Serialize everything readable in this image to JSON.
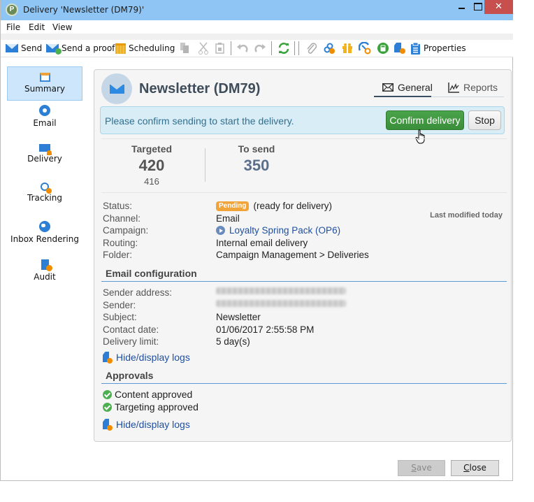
{
  "window": {
    "title": "Delivery 'Newsletter (DM79)'",
    "controls": {
      "minimize": "minimize",
      "maximize": "maximize",
      "close": "✕"
    }
  },
  "menu": [
    "File",
    "Edit",
    "View"
  ],
  "toolbar": {
    "send": "Send",
    "send_proof": "Send a proof",
    "scheduling": "Scheduling",
    "properties": "Properties",
    "icons": [
      "copy-icon",
      "cut-icon",
      "paste-icon",
      "undo-icon",
      "redo-icon",
      "refresh-icon",
      "attachment-icon",
      "tracked-link-icon",
      "offers-icon",
      "delivery-monitoring-icon",
      "calculator-icon",
      "audit-icon",
      "properties-icon"
    ]
  },
  "sidebar": {
    "items": [
      {
        "label": "Summary",
        "icon": "summary-icon",
        "active": true
      },
      {
        "label": "Email",
        "icon": "email-icon"
      },
      {
        "label": "Delivery",
        "icon": "delivery-icon"
      },
      {
        "label": "Tracking",
        "icon": "tracking-icon"
      },
      {
        "label": "Inbox Rendering",
        "icon": "inbox-rendering-icon"
      },
      {
        "label": "Audit",
        "icon": "audit-icon"
      }
    ]
  },
  "panel": {
    "title": "Newsletter (DM79)",
    "tabs": [
      {
        "label": "General",
        "active": true
      },
      {
        "label": "Reports"
      }
    ],
    "alert": {
      "message": "Please confirm sending to start the delivery.",
      "confirm_label": "Confirm delivery",
      "stop_label": "Stop"
    },
    "stats": {
      "targeted_label": "Targeted",
      "targeted_value": "420",
      "targeted_sub": "416",
      "tosend_label": "To send",
      "tosend_value": "350"
    },
    "last_modified": "Last modified today",
    "properties": {
      "status_label": "Status:",
      "status_badge": "Pending",
      "status_text": "(ready for delivery)",
      "channel_label": "Channel:",
      "channel_value": "Email",
      "campaign_label": "Campaign:",
      "campaign_value": "Loyalty Spring Pack (OP6)",
      "routing_label": "Routing:",
      "routing_value": "Internal email delivery",
      "folder_label": "Folder:",
      "folder_value": "Campaign Management > Deliveries"
    },
    "email_config": {
      "title": "Email configuration",
      "sender_address_label": "Sender address:",
      "sender_label": "Sender:",
      "subject_label": "Subject:",
      "subject_value": "Newsletter",
      "contact_date_label": "Contact date:",
      "contact_date_value": "01/06/2017 2:55:58 PM",
      "delivery_limit_label": "Delivery limit:",
      "delivery_limit_value": "5 day(s)",
      "logs_link": "Hide/display logs"
    },
    "approvals": {
      "title": "Approvals",
      "items": [
        "Content approved",
        "Targeting approved"
      ],
      "logs_link": "Hide/display logs"
    }
  },
  "footer": {
    "save_label": "Save",
    "close_label": "Close"
  },
  "colors": {
    "titlebar": "#8ec5f5",
    "close_button": "#c7504f",
    "confirm_button": "#3f9a3f",
    "alert_bg": "#d9edf7",
    "pending_badge": "#f0a43a",
    "link": "#1f4fa0"
  }
}
